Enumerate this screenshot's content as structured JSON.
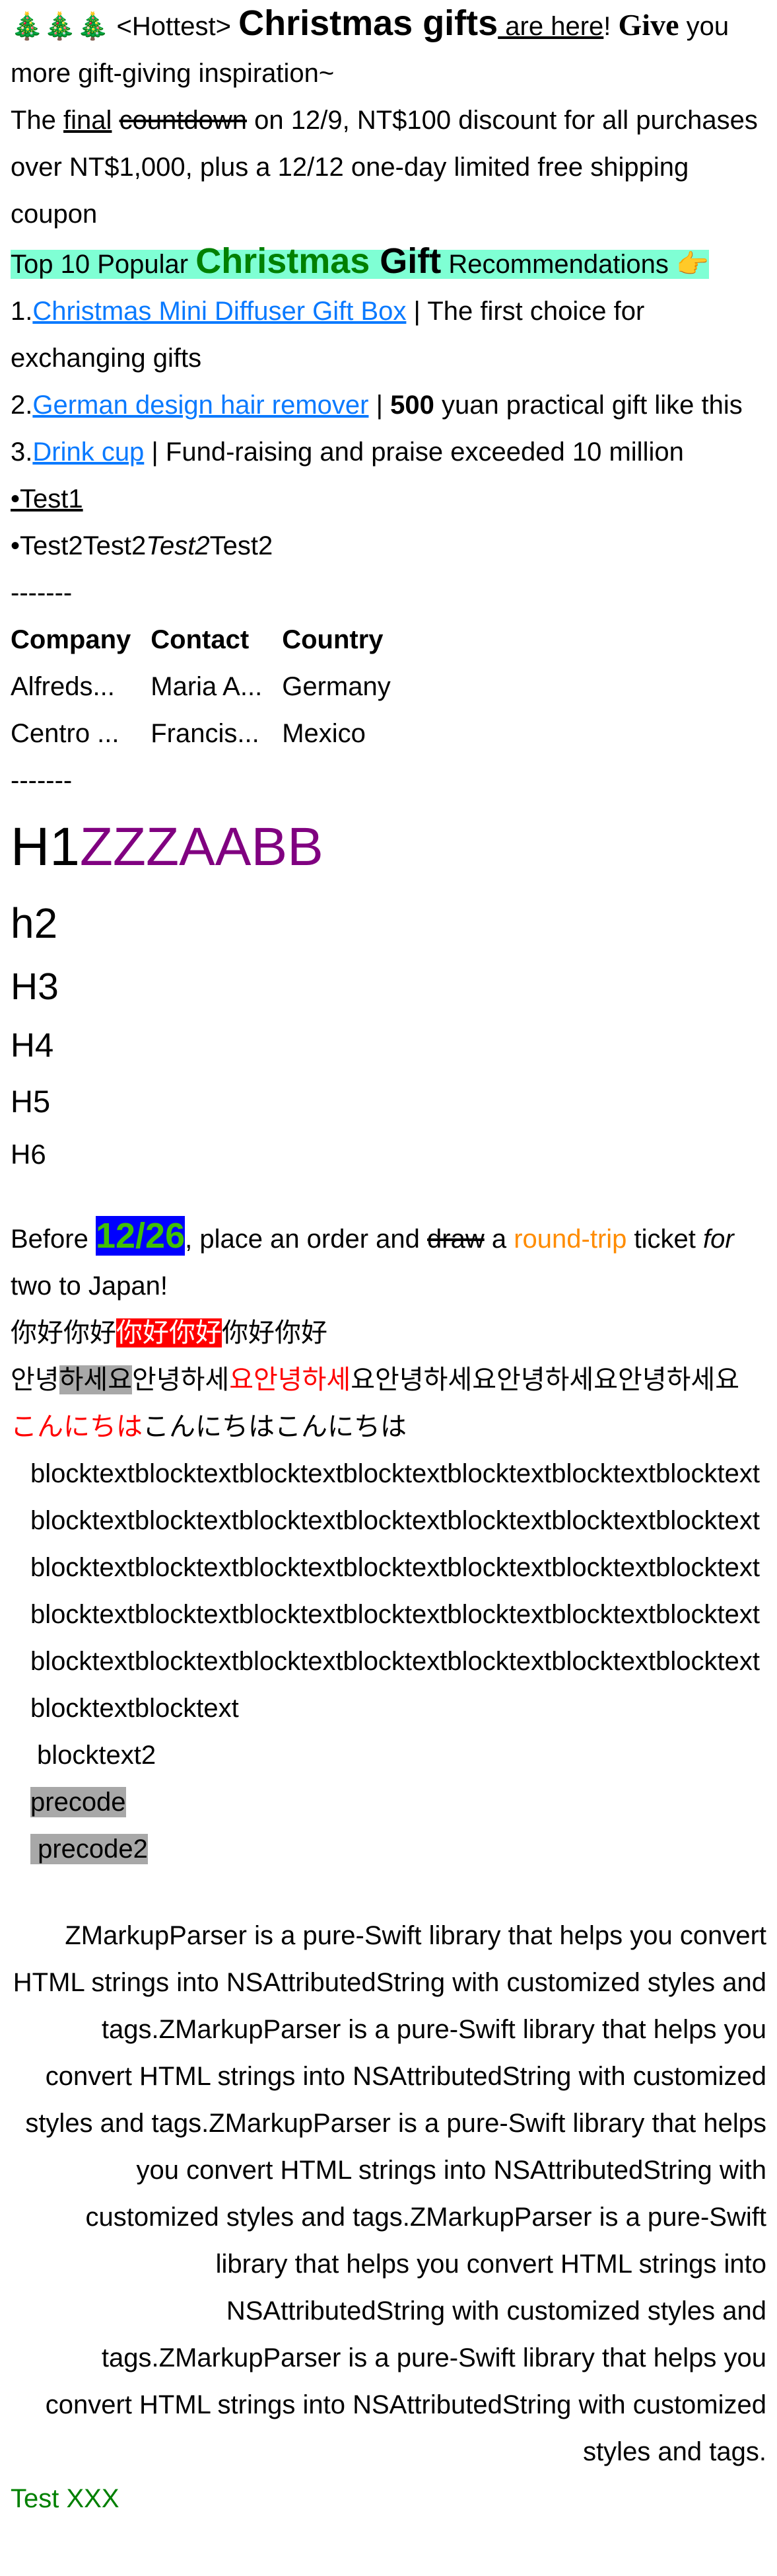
{
  "intro": {
    "tree": "🎄🎄🎄",
    "hottest": " <Hottest> ",
    "christmas_gifts": "Christmas gifts",
    "are_here": " are here",
    "excl": "! ",
    "give": "Give",
    "rest": " you more gift-giving inspiration~"
  },
  "countdown": {
    "pre": "The ",
    "final": "final",
    "countdown": "countdown",
    "post": " on 12/9, NT$100 discount for all purchases over NT$1,000, plus a 12/12 one-day limited free shipping coupon"
  },
  "top10": {
    "pre": "Top 10 Popular ",
    "christmas": "Christmas",
    "gift": " Gift",
    "post": " Recommendations 👉"
  },
  "list": [
    {
      "num": "1.",
      "link": "Christmas Mini Diffuser Gift Box",
      "text": " | The first choice for exchanging gifts"
    },
    {
      "num": "2.",
      "link": "German design hair remover",
      "text_pre": " | ",
      "bold": "500",
      "text": " yuan practical gift like this"
    },
    {
      "num": "3.",
      "link": "Drink cup",
      "text": " | Fund-raising and praise exceeded 10 million"
    }
  ],
  "bullets": {
    "b1": "•Test1",
    "b2a": "•Test2Test2",
    "b2b": "Test2",
    "b2c": "Test2"
  },
  "sep1": "-------",
  "table": {
    "headers": [
      "Company",
      "Contact",
      "Country"
    ],
    "rows": [
      [
        "Alfreds...",
        "Maria A...",
        "Germany"
      ],
      [
        "Centro ...",
        "Francis...",
        "Mexico"
      ]
    ]
  },
  "sep2": "-------",
  "headings": {
    "h1_a": "H1",
    "h1_b": "ZZZAABB",
    "h2": "h2",
    "h3": "H3",
    "h4": "H4",
    "h5": "H5",
    "h6": "H6"
  },
  "before": {
    "pre": "Before ",
    "date": "12/26",
    "mid": ", place an order and ",
    "draw": "draw",
    "a": " a ",
    "roundtrip": "round-trip",
    "ticket": " ticket ",
    "for": "for",
    "post": " two to Japan!"
  },
  "chinese": {
    "a": "你好你好",
    "b": "你好你好",
    "c": "你好你好"
  },
  "korean": {
    "a": "안녕",
    "b": "하세요",
    "c": "안녕하세",
    "d": "요안녕하세",
    "e": "요안녕하세요안녕하세요안녕하세요"
  },
  "japanese": {
    "a": "こんにちは",
    "b": "こんにちはこんにちは"
  },
  "blockquote": "blocktextblocktextblocktextblocktextblocktextblocktextblocktextblocktextblocktextblocktextblocktextblocktextblocktextblocktextblocktextblocktextblocktextblocktextblocktextblocktextblocktextblocktextblocktextblocktextblocktextblocktextblocktextblocktextblocktextblocktextblocktextblocktextblocktextblocktextblocktextblocktextblocktext",
  "blockquote2": "blocktext2",
  "pre1": "precode",
  "pre2": " precode2",
  "zmarkup": "ZMarkupParser is a pure-Swift library that helps you convert HTML strings into NSAttributedString with customized styles and tags.ZMarkupParser is a pure-Swift library that helps you convert HTML strings into NSAttributedString with customized styles and tags.ZMarkupParser is a pure-Swift library that helps you convert HTML strings into NSAttributedString with customized styles and tags.ZMarkupParser is a pure-Swift library that helps you convert HTML strings into NSAttributedString with customized styles and tags.ZMarkupParser is a pure-Swift library that helps you convert HTML strings into NSAttributedString with customized styles and tags.",
  "test_xxx": "Test XXX",
  "colors": {
    "link": "#0a7aff",
    "highlight_aqua": "#7fffd4",
    "christmas_green": "#008000",
    "heading_purple": "#800080",
    "date_bg": "#0000ff",
    "orange": "#ff8c00",
    "red": "#ff0000",
    "gray": "#a8a8a8"
  }
}
